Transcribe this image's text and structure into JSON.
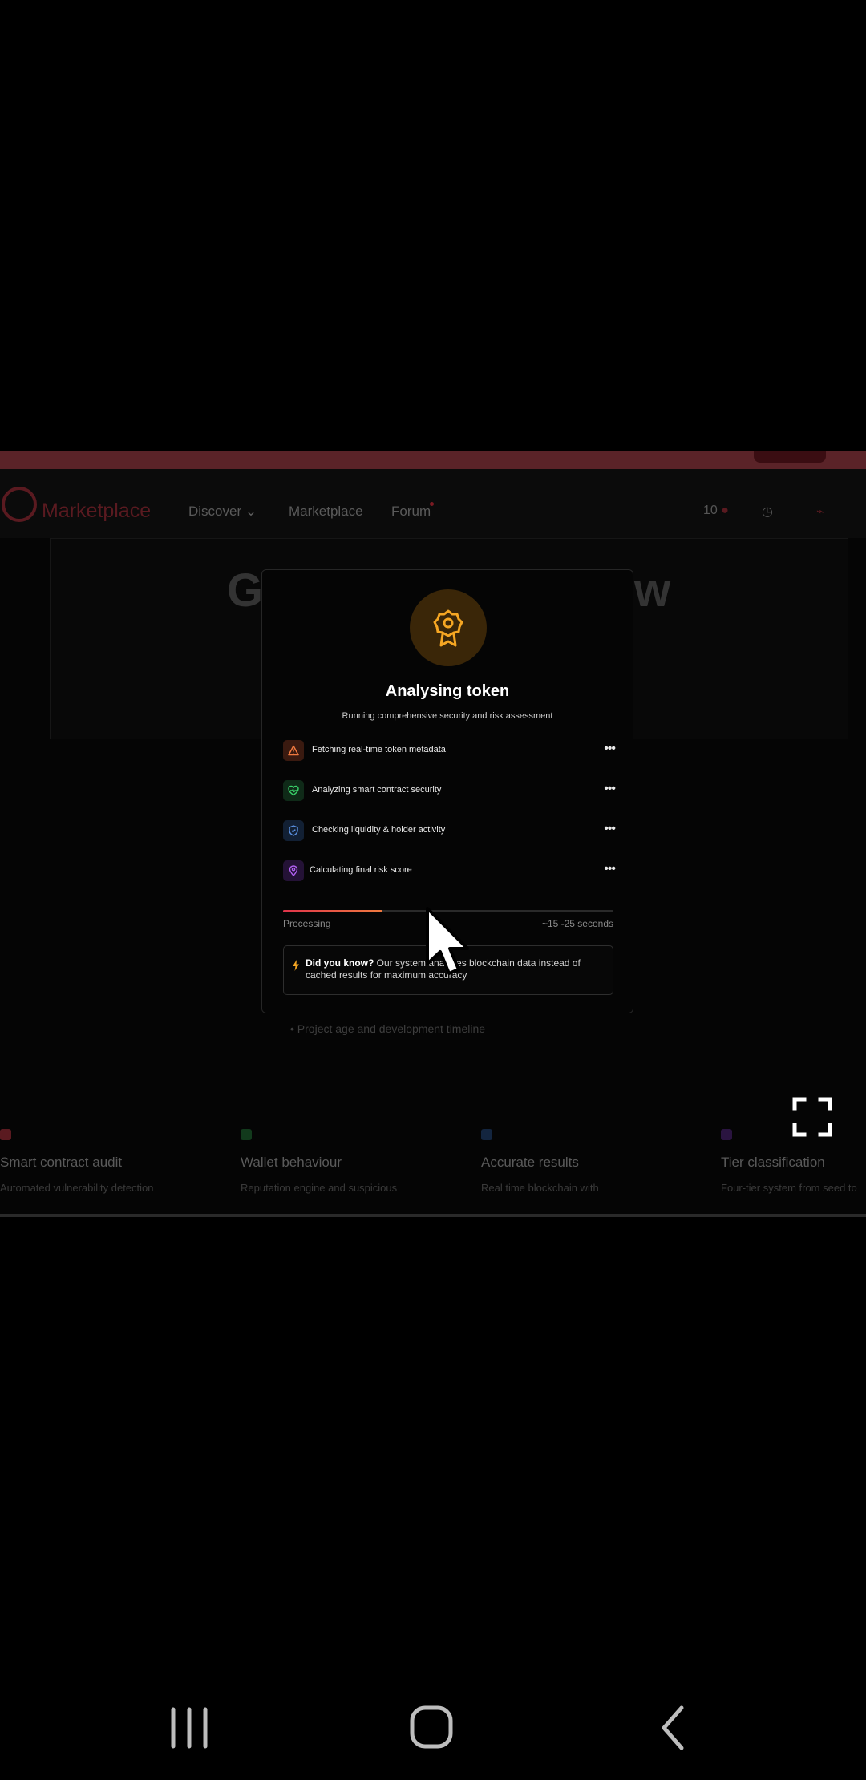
{
  "site": {
    "logo_text": "Marketplace",
    "nav": {
      "discover": "Discover",
      "marketplace": "Marketplace",
      "forum": "Forum",
      "count": "10"
    },
    "hero": {
      "left_fragment": "G",
      "right_fragment": "w"
    },
    "bullet": "• Project age and development timeline",
    "features": [
      {
        "title": "Smart contract audit",
        "desc": "Automated vulnerability detection",
        "color": "#5a1a20"
      },
      {
        "title": "Wallet behaviour",
        "desc": "Reputation engine and suspicious",
        "color": "#123a1c"
      },
      {
        "title": "Accurate results",
        "desc": "Real time blockchain with",
        "color": "#13253f"
      },
      {
        "title": "Tier classification",
        "desc": "Four-tier system from seed to",
        "color": "#2a1440"
      }
    ]
  },
  "modal": {
    "title": "Analysing token",
    "subtitle": "Running comprehensive security and risk assessment",
    "steps": [
      {
        "label": "Fetching real-time token metadata",
        "status": "•••",
        "icon": "warning-icon",
        "bg": "#3a1a10",
        "color": "#f07a40"
      },
      {
        "label": "Analyzing smart contract security",
        "status": "•••",
        "icon": "heart-pulse-icon",
        "bg": "#0f2a18",
        "color": "#3ad06a"
      },
      {
        "label": "Checking liquidity & holder activity",
        "status": "•••",
        "icon": "shield-icon",
        "bg": "#122034",
        "color": "#5a90e0"
      },
      {
        "label": "Calculating final risk score",
        "status": "•••",
        "icon": "location-pin-icon",
        "bg": "#241236",
        "color": "#b060f0"
      }
    ],
    "progress": {
      "label": "Processing",
      "eta": "~15 -25 seconds",
      "fraction": 0.3
    },
    "tip": {
      "heading": "Did you know?",
      "text": " Our system analyzes blockchain data instead of cached results for maximum accuracy"
    },
    "accent": "#f5a623"
  }
}
